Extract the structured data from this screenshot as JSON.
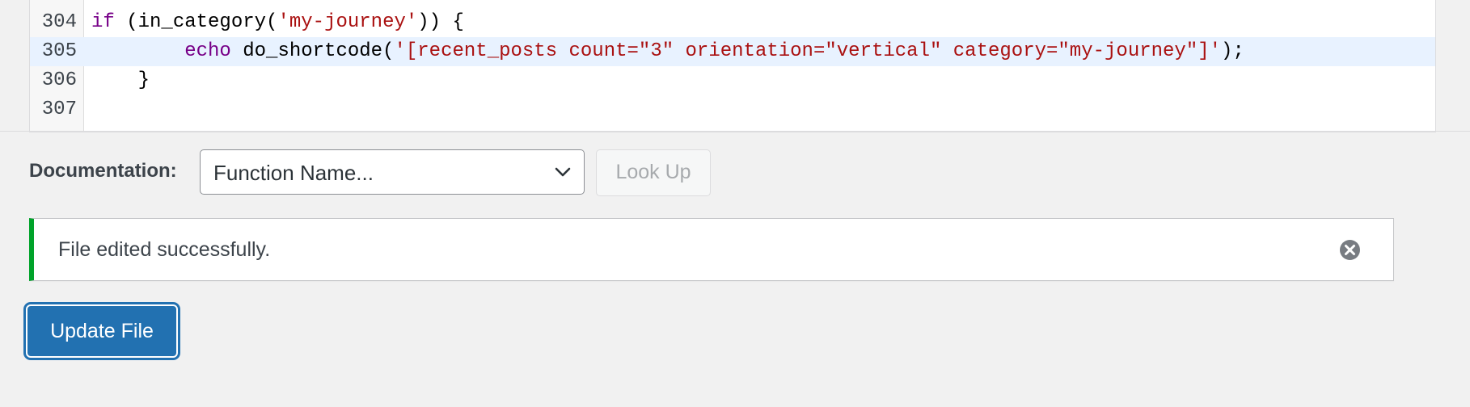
{
  "editor": {
    "lines": [
      {
        "number": "304",
        "tokens": [
          {
            "t": "if",
            "c": "kw"
          },
          {
            "t": " (in_category(",
            "c": "plain"
          },
          {
            "t": "'my-journey'",
            "c": "str"
          },
          {
            "t": ")) {",
            "c": "plain"
          }
        ]
      },
      {
        "number": "305",
        "active": true,
        "tokens": [
          {
            "t": "        ",
            "c": "plain"
          },
          {
            "t": "echo",
            "c": "kw"
          },
          {
            "t": " do_shortcode(",
            "c": "plain"
          },
          {
            "t": "'[recent_posts count=\"3\" orientation=\"vertical\" category=\"my-journey\"]'",
            "c": "str"
          },
          {
            "t": ");",
            "c": "plain"
          }
        ]
      },
      {
        "number": "306",
        "tokens": [
          {
            "t": "    }",
            "c": "plain"
          }
        ]
      },
      {
        "number": "307",
        "tokens": []
      }
    ]
  },
  "documentation": {
    "label": "Documentation:",
    "select_value": "Function Name...",
    "lookup_label": "Look Up"
  },
  "notice": {
    "message": "File edited successfully."
  },
  "actions": {
    "update_label": "Update File"
  },
  "colors": {
    "accent": "#2271b1",
    "success": "#00a32a",
    "keyword": "#770088",
    "string": "#aa1111"
  },
  "icons": {
    "select": "chevron-down-icon",
    "dismiss": "dismiss-icon"
  }
}
